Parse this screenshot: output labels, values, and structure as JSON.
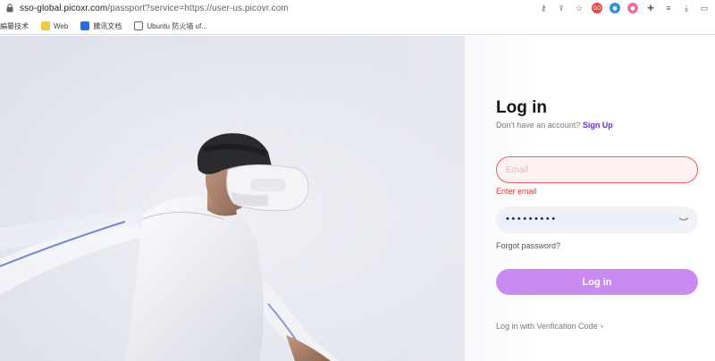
{
  "browser": {
    "url_host": "sso-global.picoxr.com",
    "url_path": "/passport?service=https://user-us.picovr.com",
    "extensions": [
      {
        "icon": "key-icon",
        "glyph": "⚷"
      },
      {
        "icon": "share-icon",
        "glyph": "⇪"
      },
      {
        "icon": "star-icon",
        "glyph": "☆"
      },
      {
        "icon": "extension-red-icon",
        "glyph": "GO",
        "color": "#e8453c"
      },
      {
        "icon": "extension-blue-icon",
        "glyph": "●",
        "color": "#2f8fe8"
      },
      {
        "icon": "extension-pink-icon",
        "glyph": "●",
        "color": "#e86fa0"
      },
      {
        "icon": "puzzle-icon",
        "glyph": "✚"
      },
      {
        "icon": "reading-list-icon",
        "glyph": "≡"
      },
      {
        "icon": "download-icon",
        "glyph": "⤓"
      },
      {
        "icon": "sidebar-icon",
        "glyph": "▭"
      }
    ]
  },
  "bookmarks": [
    {
      "label": "編纂技术",
      "icon": "bookmark-icon",
      "color": "#e0e0e0"
    },
    {
      "label": "Web",
      "icon": "folder-icon",
      "color": "#f2c744"
    },
    {
      "label": "騰讯文档",
      "icon": "docs-icon",
      "color": "#2b6be0"
    },
    {
      "label": "Ubuntu 防火墙 uf...",
      "icon": "ubuntu-icon",
      "color": "#ffffff"
    }
  ],
  "login": {
    "title": "Log in",
    "no_account": "Don't have an account?",
    "signup": "Sign Up",
    "email_placeholder": "Email",
    "email_error": "Enter email",
    "password_value": "•••••••••",
    "forgot": "Forgot password?",
    "login_button": "Log in",
    "verification_link": "Log in with Verification Code",
    "verification_chevron": "›"
  },
  "colors": {
    "accent": "#6b2bd9",
    "button": "#c98af2",
    "error": "#e03b3b"
  }
}
